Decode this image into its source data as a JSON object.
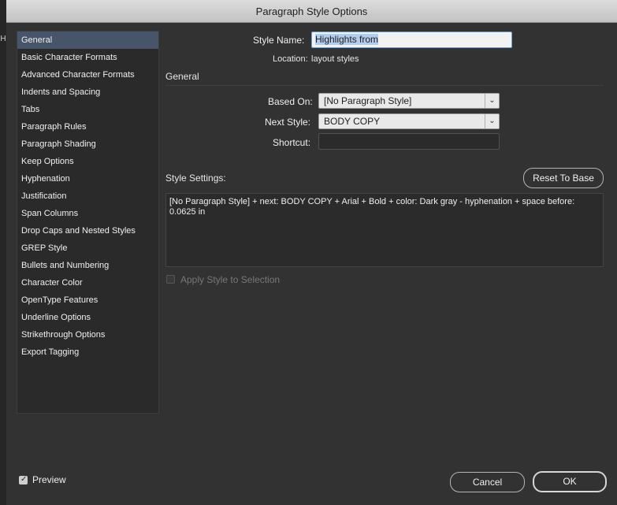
{
  "window": {
    "title": "Paragraph Style Options"
  },
  "edge_marks": [
    "H"
  ],
  "nav": {
    "items": [
      {
        "label": "General",
        "selected": true
      },
      {
        "label": "Basic Character Formats"
      },
      {
        "label": "Advanced Character Formats"
      },
      {
        "label": "Indents and Spacing"
      },
      {
        "label": "Tabs"
      },
      {
        "label": "Paragraph Rules"
      },
      {
        "label": "Paragraph Shading"
      },
      {
        "label": "Keep Options"
      },
      {
        "label": "Hyphenation"
      },
      {
        "label": "Justification"
      },
      {
        "label": "Span Columns"
      },
      {
        "label": "Drop Caps and Nested Styles"
      },
      {
        "label": "GREP Style"
      },
      {
        "label": "Bullets and Numbering"
      },
      {
        "label": "Character Color"
      },
      {
        "label": "OpenType Features"
      },
      {
        "label": "Underline Options"
      },
      {
        "label": "Strikethrough Options"
      },
      {
        "label": "Export Tagging"
      }
    ]
  },
  "form": {
    "style_name_label": "Style Name:",
    "style_name_value": "Highlights from",
    "location_label": "Location:",
    "location_value": "layout styles",
    "section_heading": "General",
    "based_on_label": "Based On:",
    "based_on_value": "[No Paragraph Style]",
    "next_style_label": "Next Style:",
    "next_style_value": "BODY COPY",
    "shortcut_label": "Shortcut:",
    "shortcut_value": "",
    "style_settings_label": "Style Settings:",
    "reset_button": "Reset To Base",
    "style_settings_text": "[No Paragraph Style] + next: BODY COPY + Arial + Bold + color: Dark gray - hyphenation + space before: 0.0625 in",
    "apply_style_label": "Apply Style to Selection"
  },
  "footer": {
    "preview_label": "Preview",
    "preview_checked": true,
    "cancel_button": "Cancel",
    "ok_button": "OK"
  },
  "icons": {
    "dropdown_arrow": "chevron-down-icon",
    "check": "checkmark-icon"
  },
  "colors": {
    "selection": "#46556a",
    "input_focus": "#6aa0d8",
    "text_highlight": "#b3cdef"
  }
}
